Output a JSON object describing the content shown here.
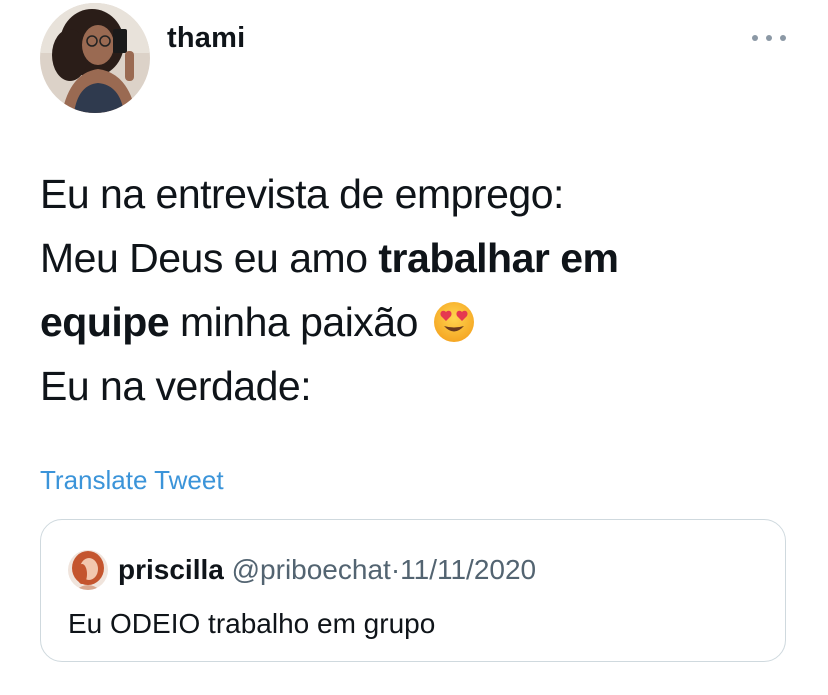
{
  "tweet": {
    "author": {
      "display_name": "thami"
    },
    "text": {
      "line1": "Eu na entrevista de emprego:",
      "line2_pre": "Meu Deus eu amo ",
      "line2_bold": "trabalhar em",
      "line3_bold": "equipe",
      "line3_post": " minha paixão",
      "line3_emoji": "smiling-face-with-heart-eyes",
      "line4": "Eu na verdade:"
    },
    "translate_label": "Translate Tweet",
    "more_icon": "more-horizontal-icon"
  },
  "quoted_tweet": {
    "display_name": "priscilla",
    "handle": "@priboechat",
    "separator": "·",
    "date": "11/11/2020",
    "text": "Eu ODEIO trabalho em grupo"
  },
  "colors": {
    "link": "#3b94d9",
    "secondary_text": "#536471",
    "border": "#cfd9de",
    "text": "#0f1419"
  }
}
